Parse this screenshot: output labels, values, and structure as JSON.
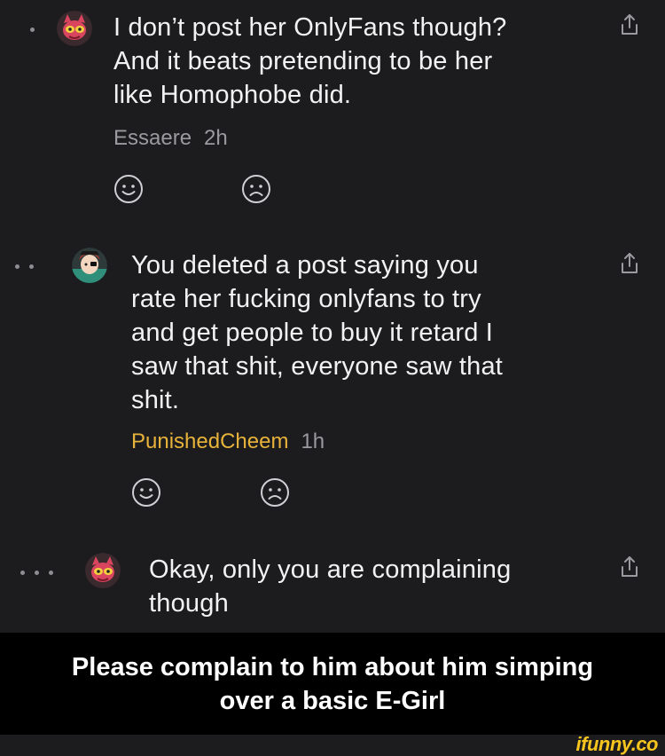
{
  "comments": [
    {
      "text_lines": [
        "I don’t post her OnlyFans though?",
        "And it beats pretending to be her",
        "like Homophobe did."
      ],
      "author": "Essaere",
      "time": "2h",
      "author_color": "#9a9a9f"
    },
    {
      "text_lines": [
        "You deleted a post saying you",
        "rate her fucking onlyfans to try",
        "and get people to buy it retard I",
        "saw that shit, everyone saw that",
        "shit."
      ],
      "author": "PunishedCheem",
      "time": "1h",
      "author_color": "#e8b33a"
    },
    {
      "text_lines": [
        "Okay, only you are complaining",
        "though"
      ]
    }
  ],
  "caption": {
    "lines": [
      "Please complain to him about him simping",
      "over a basic E-Girl"
    ]
  },
  "watermark": "ifunny.co",
  "icons": [
    "avatar-red-character-icon",
    "avatar-anime-character-icon",
    "smile-icon",
    "frown-icon",
    "share-icon"
  ],
  "colors": {
    "background": "#1c1c1e",
    "text": "#f2f2f2",
    "muted": "#9a9a9f",
    "highlight_author": "#e8b33a",
    "watermark": "#f7c51e"
  }
}
